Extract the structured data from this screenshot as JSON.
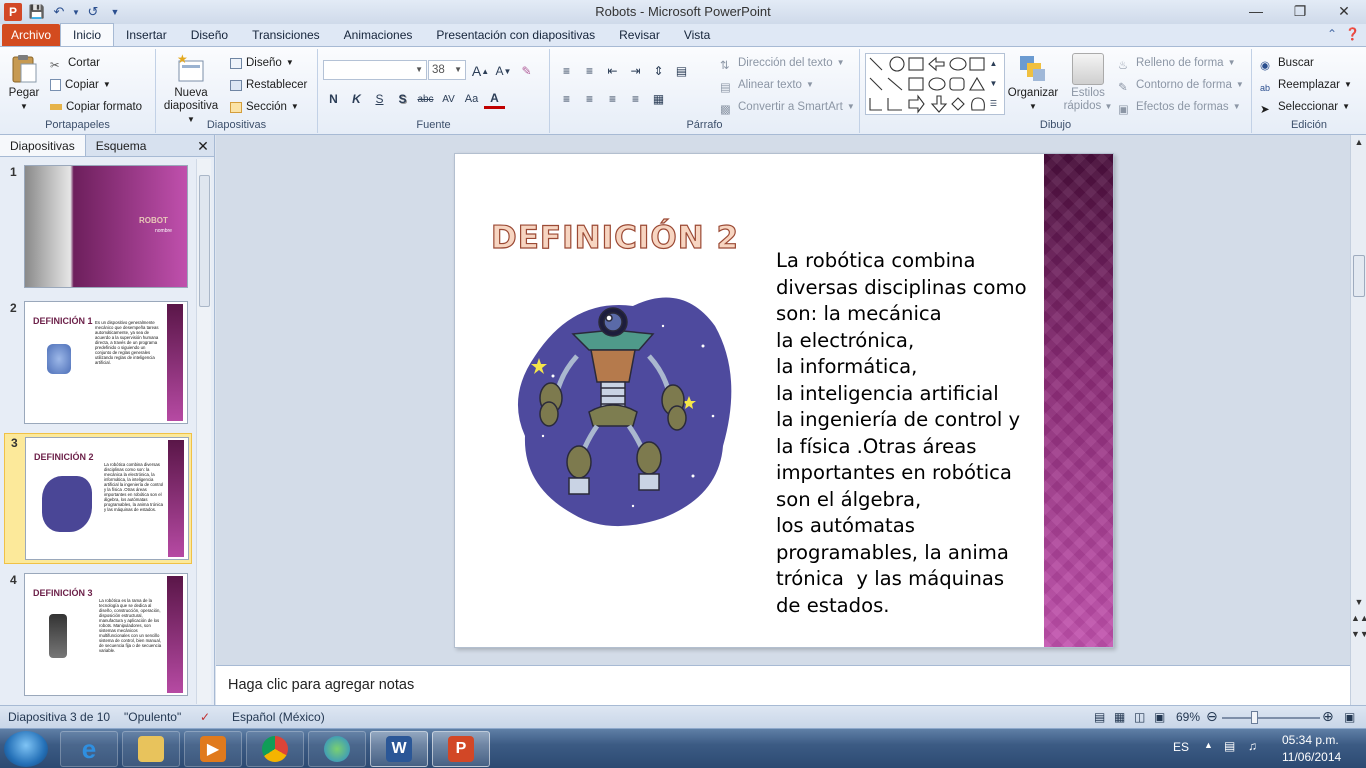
{
  "window": {
    "title": "Robots - Microsoft PowerPoint",
    "app_letter": "P"
  },
  "ribbon_tabs": [
    "Archivo",
    "Inicio",
    "Insertar",
    "Diseño",
    "Transiciones",
    "Animaciones",
    "Presentación con diapositivas",
    "Revisar",
    "Vista"
  ],
  "ribbon": {
    "clipboard": {
      "paste": "Pegar",
      "cut": "Cortar",
      "copy": "Copiar",
      "format_painter": "Copiar formato",
      "label": "Portapapeles"
    },
    "slides": {
      "new_slide_1": "Nueva",
      "new_slide_2": "diapositiva",
      "layout": "Diseño",
      "reset": "Restablecer",
      "section": "Sección",
      "label": "Diapositivas"
    },
    "font": {
      "font_size": "38",
      "label": "Fuente"
    },
    "paragraph": {
      "text_direction": "Dirección del texto",
      "align_text": "Alinear texto",
      "smartart": "Convertir a SmartArt",
      "label": "Párrafo"
    },
    "drawing": {
      "arrange": "Organizar",
      "quick_styles_1": "Estilos",
      "quick_styles_2": "rápidos",
      "shape_fill": "Relleno de forma",
      "shape_outline": "Contorno de forma",
      "shape_effects": "Efectos de formas",
      "label": "Dibujo"
    },
    "editing": {
      "find": "Buscar",
      "replace": "Reemplazar",
      "select": "Seleccionar",
      "label": "Edición"
    }
  },
  "side_panel": {
    "tabs": [
      "Diapositivas",
      "Esquema"
    ],
    "slides": [
      {
        "num": "1",
        "title": "ROBOT",
        "subtitle": "nombre"
      },
      {
        "num": "2",
        "title": "DEFINICIÓN 1",
        "text": "Es un dispositivo generalmente mecánico que desempeña tareas automáticamente, ya sea de acuerdo a la supervisión humana directa, a través de un programa predefinido o siguiendo un conjunto de reglas generales utilizando reglas de inteligencia artificial."
      },
      {
        "num": "3",
        "title": "DEFINICIÓN 2",
        "text": "La robótica combina diversas disciplinas como son: la mecánica la electrónica, la informática, la inteligencia artificial la ingeniería de control y la física .Otras áreas importantes en robótica son el álgebra, los autómatas programables, la anima trónica y las máquinas de estados."
      },
      {
        "num": "4",
        "title": "DEFINICIÓN 3",
        "text": "La robótica es la rama de la tecnología que se dedica al diseño, construcción, operación, disposición estructural, manufactura y aplicación de los robots. Manipuladores, son sistemas mecánicos multifuncionales con un sencillo sistema de control, bien manual, de secuencia fija o de secuencia variable."
      }
    ]
  },
  "slide": {
    "title": "DEFINICIÓN 2",
    "lines": [
      "La robótica combina",
      "diversas disciplinas como",
      "son: la mecánica",
      "la electrónica,",
      "la informática,",
      "la inteligencia artificial",
      "la ingeniería de control y",
      "la física .Otras áreas",
      "importantes en robótica",
      "son el álgebra,",
      "los autómatas",
      "programables, la anima",
      "trónica  y las máquinas",
      "de estados."
    ]
  },
  "notes_placeholder": "Haga clic para agregar notas",
  "status_bar": {
    "slide_info": "Diapositiva 3 de 10",
    "theme": "\"Opulento\"",
    "language": "Español (México)",
    "zoom": "69%"
  },
  "taskbar": {
    "lang": "ES",
    "time": "05:34 p.m.",
    "date": "11/06/2014"
  },
  "colors": {
    "accent": "#d34b1f",
    "slide_bar": "#8d2c78",
    "title_fill": "#f7d5c1"
  }
}
